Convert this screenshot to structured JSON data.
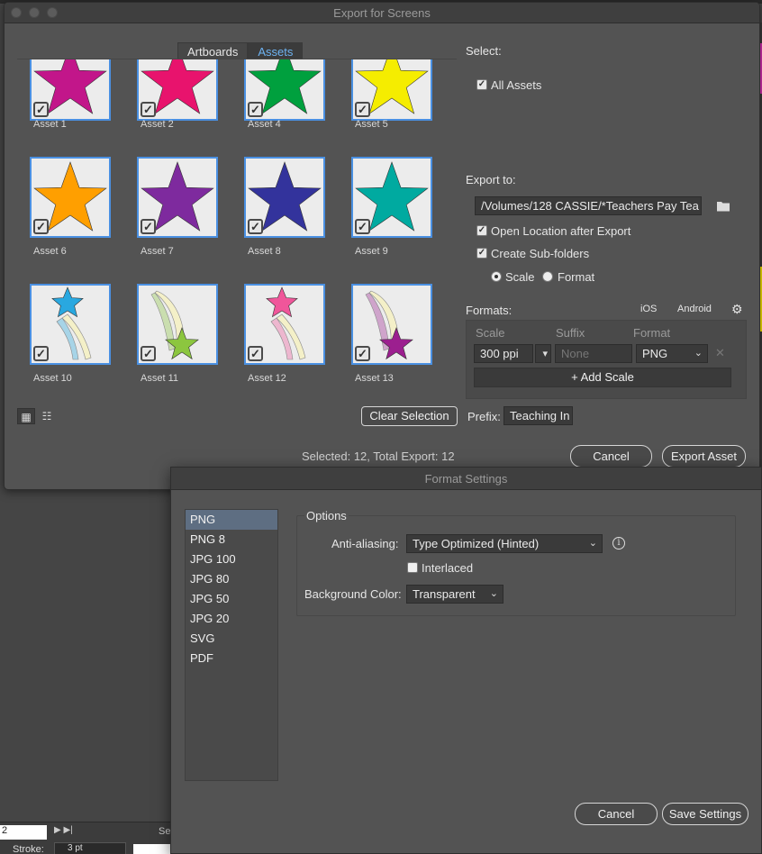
{
  "export_dialog": {
    "title": "Export for Screens",
    "tabs": [
      {
        "label": "Artboards"
      },
      {
        "label": "Assets"
      }
    ],
    "assets": [
      {
        "label": "Asset 1",
        "icon": "magenta-star-icon",
        "color": "#c2168a",
        "checked": true
      },
      {
        "label": "Asset 2",
        "icon": "pink-star-icon",
        "color": "#e8136d",
        "checked": true
      },
      {
        "label": "Asset 4",
        "icon": "green-star-icon",
        "color": "#00a03e",
        "checked": true
      },
      {
        "label": "Asset 5",
        "icon": "yellow-star-icon",
        "color": "#f5ed00",
        "checked": true
      },
      {
        "label": "Asset 6",
        "icon": "orange-star-icon",
        "color": "#ff9f00",
        "checked": true
      },
      {
        "label": "Asset 7",
        "icon": "purple-star-icon",
        "color": "#7e2a9e",
        "checked": true
      },
      {
        "label": "Asset 8",
        "icon": "navy-star-icon",
        "color": "#33339c",
        "checked": true
      },
      {
        "label": "Asset 9",
        "icon": "teal-star-icon",
        "color": "#00aaa0",
        "checked": true
      },
      {
        "label": "Asset 10",
        "icon": "blue-shooting-star-icon",
        "color": "#29a8e0",
        "checked": true
      },
      {
        "label": "Asset 11",
        "icon": "lime-shooting-star-icon",
        "color": "#8cc63f",
        "checked": true
      },
      {
        "label": "Asset 12",
        "icon": "pink-shooting-star-icon",
        "color": "#f0569a",
        "checked": true
      },
      {
        "label": "Asset 13",
        "icon": "purple-shooting-star-icon",
        "color": "#9c1f8f",
        "checked": true
      }
    ],
    "clear_selection_label": "Clear Selection",
    "prefix_label": "Prefix:",
    "prefix_value": "Teaching In",
    "status": "Selected: 12, Total Export: 12",
    "cancel_label": "Cancel",
    "export_label": "Export Asset",
    "select_heading": "Select:",
    "all_assets_label": "All Assets",
    "export_to_heading": "Export to:",
    "export_path": "/Volumes/128 CASSIE/*Teachers Pay Tea",
    "open_location_label": "Open Location after Export",
    "create_subfolders_label": "Create Sub-folders",
    "subfolder_scale_label": "Scale",
    "subfolder_format_label": "Format",
    "formats_heading": "Formats:",
    "ios_label": "iOS",
    "android_label": "Android",
    "col_scale": "Scale",
    "col_suffix": "Suffix",
    "col_format": "Format",
    "scale_value": "300 ppi",
    "suffix_placeholder": "None",
    "format_value": "PNG",
    "add_scale_label": "+ Add Scale"
  },
  "format_settings": {
    "title": "Format Settings",
    "formats": [
      "PNG",
      "PNG 8",
      "JPG 100",
      "JPG 80",
      "JPG 50",
      "JPG 20",
      "SVG",
      "PDF"
    ],
    "options_heading": "Options",
    "antialiasing_label": "Anti-aliasing:",
    "antialiasing_value": "Type Optimized (Hinted)",
    "interlaced_label": "Interlaced",
    "background_label": "Background Color:",
    "background_value": "Transparent",
    "cancel_label": "Cancel",
    "save_label": "Save Settings"
  },
  "background": {
    "zoom_value": "2",
    "stroke_label": "Stroke:",
    "stroke_value": "3 pt",
    "sel_text": "Sel"
  }
}
